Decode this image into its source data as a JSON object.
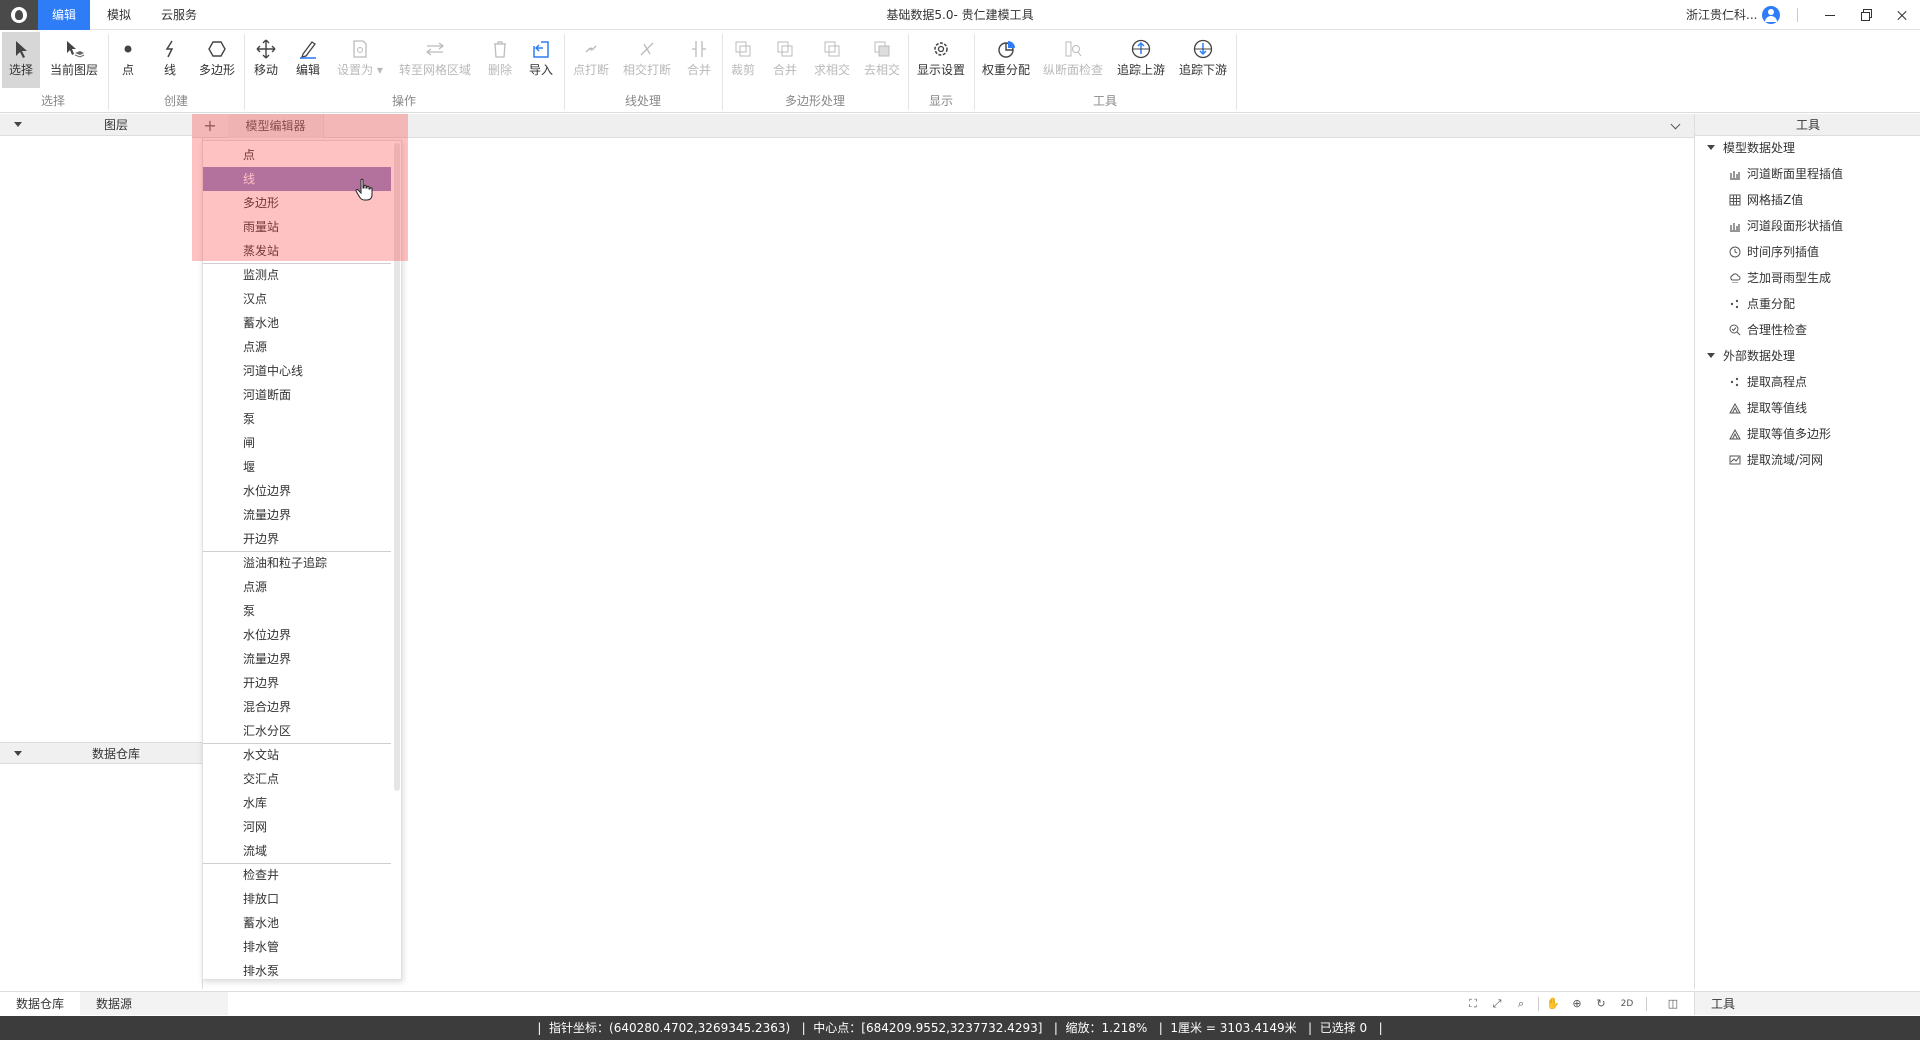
{
  "titlebar": {
    "tabs": [
      "编辑",
      "模拟",
      "云服务"
    ],
    "window_title": "基础数据5.0- 贵仁建模工具",
    "company": "浙江贵仁科..."
  },
  "ribbon": {
    "buttons": {
      "select": "选择",
      "current_layer": "当前图层",
      "point": "点",
      "line": "线",
      "polygon": "多边形",
      "move": "移动",
      "edit": "编辑",
      "set_as": "设置为",
      "to_grid_area": "转至网格区域",
      "delete": "删除",
      "import": "导入",
      "point_break": "点打断",
      "intersect_break": "相交打断",
      "merge_line": "合并",
      "clip": "裁剪",
      "merge_poly": "合并",
      "intersect": "求相交",
      "remove_intersect": "去相交",
      "display_settings": "显示设置",
      "weight_distribution": "权重分配",
      "section_check": "纵断面检查",
      "trace_upstream": "追踪上游",
      "trace_downstream": "追踪下游"
    },
    "groups": {
      "select": "选择",
      "create": "创建",
      "operate": "操作",
      "line_proc": "线处理",
      "poly_proc": "多边形处理",
      "display": "显示",
      "tools": "工具"
    }
  },
  "left_panel": {
    "layers_title": "图层",
    "warehouse_title": "数据仓库"
  },
  "main": {
    "tab_label": "模型编辑器",
    "plus": "+"
  },
  "dropdown": {
    "selected_index": 1,
    "items": [
      "点",
      "线",
      "多边形",
      "雨量站",
      "蒸发站",
      "监测点",
      "汉点",
      "蓄水池",
      "点源",
      "河道中心线",
      "河道断面",
      "泵",
      "闸",
      "堰",
      "水位边界",
      "流量边界",
      "开边界",
      "溢油和粒子追踪",
      "点源",
      "泵",
      "水位边界",
      "流量边界",
      "开边界",
      "混合边界",
      "汇水分区",
      "水文站",
      "交汇点",
      "水库",
      "河网",
      "流域",
      "检查井",
      "排放口",
      "蓄水池",
      "排水管",
      "排水泵"
    ],
    "separators_after": [
      4,
      16,
      24,
      29
    ]
  },
  "right_panel": {
    "title": "工具",
    "groups": [
      {
        "label": "模型数据处理",
        "items": [
          {
            "label": "河道断面里程插值",
            "icon": "bar-chart-icon"
          },
          {
            "label": "网格插Z值",
            "icon": "grid-icon"
          },
          {
            "label": "河道段面形状插值",
            "icon": "bar-chart-icon"
          },
          {
            "label": "时间序列插值",
            "icon": "clock-icon"
          },
          {
            "label": "芝加哥雨型生成",
            "icon": "cloud-icon"
          },
          {
            "label": "点重分配",
            "icon": "scatter-icon"
          },
          {
            "label": "合理性检查",
            "icon": "check-search-icon"
          }
        ]
      },
      {
        "label": "外部数据处理",
        "items": [
          {
            "label": "提取高程点",
            "icon": "scatter-icon"
          },
          {
            "label": "提取等值线",
            "icon": "contour-icon"
          },
          {
            "label": "提取等值多边形",
            "icon": "contour-icon"
          },
          {
            "label": "提取流域/河网",
            "icon": "map-icon"
          }
        ]
      }
    ]
  },
  "bottom": {
    "tabs": [
      "数据仓库",
      "数据源"
    ],
    "right_label": "工具",
    "zoom_2d": "2D"
  },
  "status": {
    "text": "|  指针坐标：(640280.4702,3269345.2363)   |  中心点：[684209.9552,3237732.4293]   |  缩放：1.218%   |  1厘米 = 3103.4149米   |  已选择 0   |"
  }
}
